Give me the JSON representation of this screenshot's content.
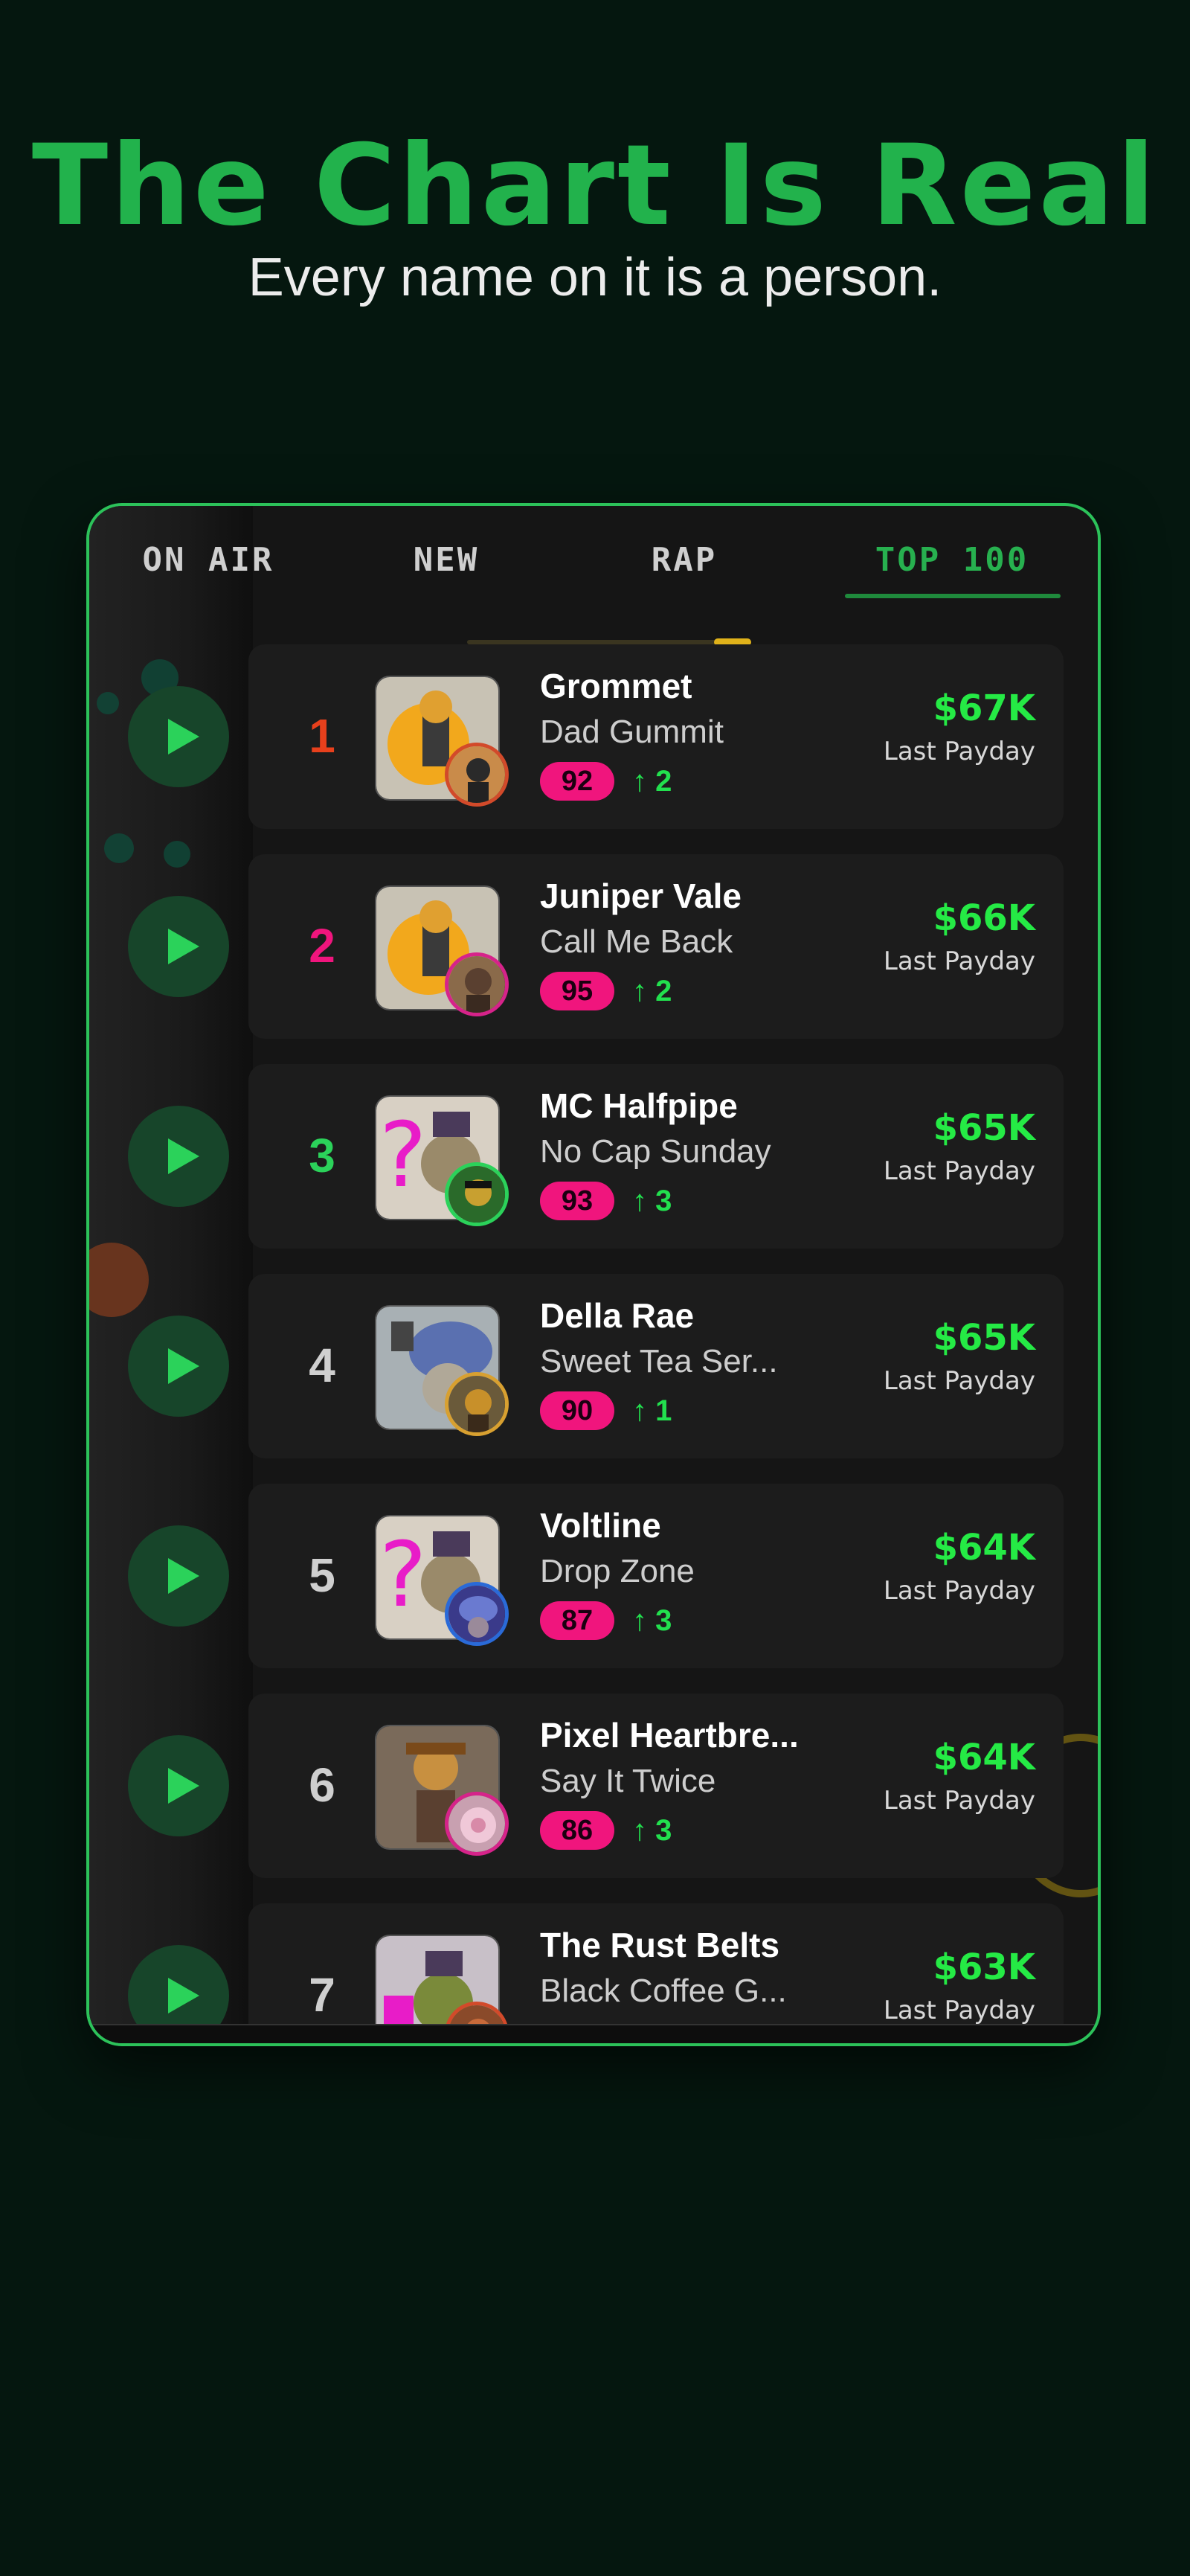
{
  "header": {
    "title": "The Chart Is Real",
    "subtitle": "Every name on it is a person."
  },
  "tabs": [
    {
      "label": "ON AIR",
      "active": false
    },
    {
      "label": "NEW",
      "active": false
    },
    {
      "label": "RAP",
      "active": false
    },
    {
      "label": "TOP 100",
      "active": true
    }
  ],
  "colors": {
    "accent": "#27b04f",
    "payday": "#25ea45",
    "score_badge": "#f0157d",
    "rank_1": "#e8401c",
    "rank_2": "#f0157d",
    "rank_3": "#2bd25a"
  },
  "chart": [
    {
      "rank": "1",
      "artist": "Grommet",
      "track": "Dad Gummit",
      "score": "92",
      "move": "↑ 2",
      "payday": "$67K",
      "payday_label": "Last Payday"
    },
    {
      "rank": "2",
      "artist": "Juniper Vale",
      "track": "Call Me Back",
      "score": "95",
      "move": "↑ 2",
      "payday": "$66K",
      "payday_label": "Last Payday"
    },
    {
      "rank": "3",
      "artist": "MC Halfpipe",
      "track": "No Cap Sunday",
      "score": "93",
      "move": "↑ 3",
      "payday": "$65K",
      "payday_label": "Last Payday"
    },
    {
      "rank": "4",
      "artist": "Della Rae",
      "track": "Sweet Tea Ser...",
      "score": "90",
      "move": "↑ 1",
      "payday": "$65K",
      "payday_label": "Last Payday"
    },
    {
      "rank": "5",
      "artist": "Voltline",
      "track": "Drop Zone",
      "score": "87",
      "move": "↑ 3",
      "payday": "$64K",
      "payday_label": "Last Payday"
    },
    {
      "rank": "6",
      "artist": "Pixel Heartbre...",
      "track": "Say It Twice",
      "score": "86",
      "move": "↑ 3",
      "payday": "$64K",
      "payday_label": "Last Payday"
    },
    {
      "rank": "7",
      "artist": "The Rust Belts",
      "track": "Black Coffee G...",
      "score": "",
      "move": "",
      "payday": "$63K",
      "payday_label": "Last Payday"
    }
  ]
}
